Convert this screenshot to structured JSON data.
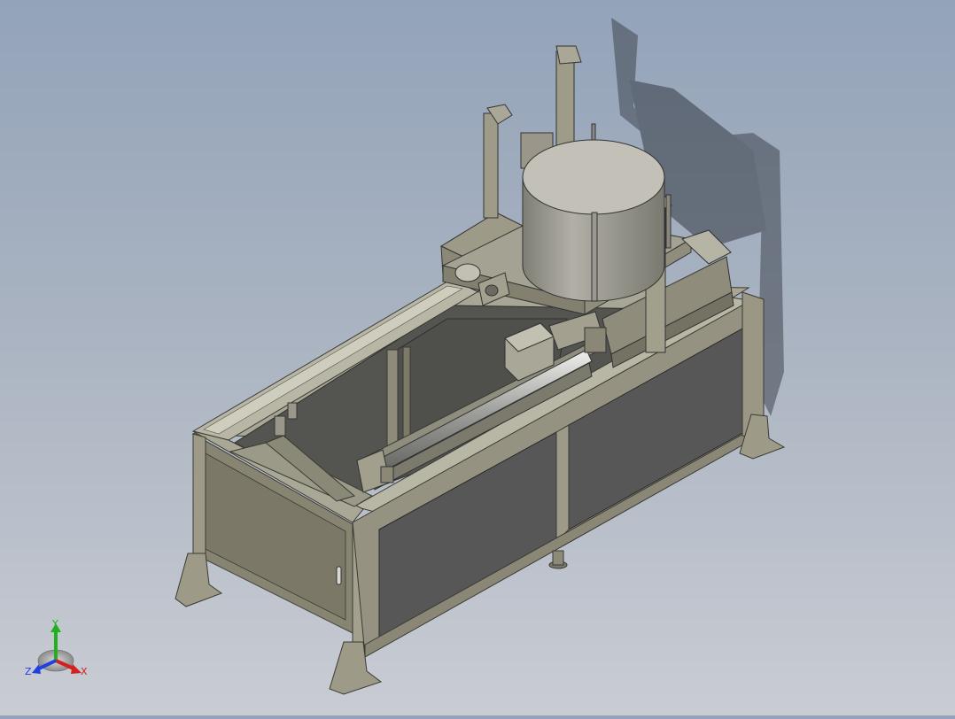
{
  "viewport": {
    "background_top": "#93a3b9",
    "background_bottom": "#c9ccd3"
  },
  "model": {
    "frame_color": "#8d8a78",
    "panel_color": "#5a5a5a",
    "component_color": "#9a978a"
  },
  "triad": {
    "x_label": "X",
    "y_label": "Y",
    "z_label": "Z",
    "x_color": "#d42020",
    "y_color": "#20b020",
    "z_color": "#2040e0"
  }
}
